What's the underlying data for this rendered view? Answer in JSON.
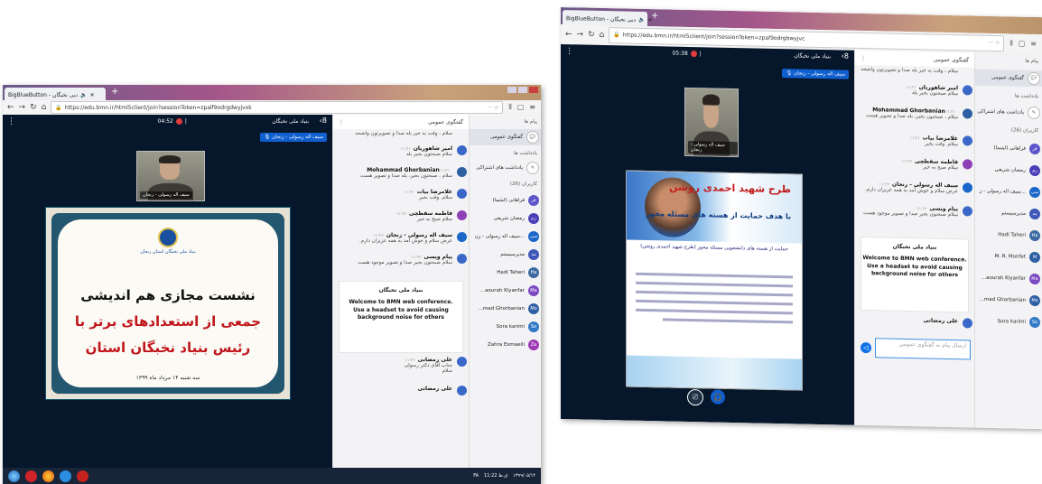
{
  "browser": {
    "tab_title": "BigBlueButton - دبی نخبگان",
    "tab_audio": "🔈",
    "tab_close": "✕",
    "new_tab": "+",
    "url": "https://edu.bmn.ir/html5client/join?sessionToken=zpalf9odrgdwyjvxk",
    "url_right": "https://edu.bmn.ir/html5client/join?sessionToken=zpaf9odrgbwyjvc"
  },
  "left": {
    "meeting_title": "بنیاد ملی نخبگان",
    "timer": "04:52",
    "speaker_badge": "🎙 سیف اله رسولی - زنجان",
    "webcam_caption": "سیف اله رسولی - زنجان",
    "slide": {
      "org": "بنیاد ملی نخبگان استان زنجان",
      "line1": "نشست مجازی هم اندیشی",
      "line2": "جمعی از استعدادهای برتر با",
      "line3": "رئیس بنیاد نخبگان استان",
      "date": "سه شنبه ۱۴ مرداد ماه ۱۳۹۹"
    },
    "chat_header": "گفتگوی عمومی",
    "messages": [
      {
        "name": "",
        "time": "",
        "text": "سلام ، وقت به خیر بله صدا و تصویرتون واضحه"
      },
      {
        "name": "امیر شاهوریان",
        "time": "۱۱:۲۱",
        "text": "سلام صبحتون بخیر بله"
      },
      {
        "name": "Mohammad Ghorbanian",
        "time": "۱۱:۲۱",
        "text": "سلام ، صبحتون بخیر، بله صدا و تصویر هست"
      },
      {
        "name": "غلامرضا بیات",
        "time": "۱۱:۲۱",
        "text": "سلام. وقت بخیر"
      },
      {
        "name": "فاطمه سقطچی",
        "time": "۱۱:۲۲",
        "text": "سلام صبح به خیر"
      },
      {
        "name": "سیف اله رسولی - زنجان",
        "time": "۱۱:۲۲",
        "text": "عرض سلام و خوش آمد به همه عزیزان دارم."
      },
      {
        "name": "پیام ویسی",
        "time": "۱۱:۲۲",
        "text": "سلام صبحتون بخیر صدا و تصویر موجود هست"
      }
    ],
    "welcome": {
      "title": "بنیاد ملی نخبگان",
      "line1": "Welcome to BMN web conference.",
      "line2": "Use a headset to avoid causing",
      "line3": "background noise for others"
    },
    "msg_after": [
      {
        "name": "علی رمضانی",
        "time": "۱۱:۲۲",
        "text": "جناب آقای دکتر رسولی"
      },
      {
        "name": "",
        "time": "",
        "text": "سلام"
      },
      {
        "name": "علی رمضانی",
        "time": "",
        "text": ""
      }
    ],
    "side": {
      "messages_header": "پیام ها",
      "chat_item": "گفتگوی عمومی",
      "notes_header": "یادداشت ها",
      "notes_item": "یادداشت های اشتراکی",
      "users_header": "کاربران (26)",
      "users": [
        {
          "name": "فراهانی (لشما)",
          "initial": "فر",
          "color": "#5b55c9"
        },
        {
          "name": "رمضان شریفی",
          "initial": "رم",
          "color": "#4a3fb8"
        },
        {
          "name": "سیف اله رسولی - زن...",
          "initial": "سی",
          "color": "#1a66c9"
        },
        {
          "name": "مدیرسیستم",
          "initial": "مد",
          "color": "#3f57b8"
        },
        {
          "name": "Hadi Taheri",
          "initial": "Ha",
          "color": "#3d6ba1"
        },
        {
          "name": "...aourah Kiyanfar",
          "initial": "Ma",
          "color": "#7b48c2"
        },
        {
          "name": "...mad Ghorbanian",
          "initial": "Mo",
          "color": "#2d5fa3"
        },
        {
          "name": "Sora karimi",
          "initial": "So",
          "color": "#327ac7"
        },
        {
          "name": "Zahra Esmaeili",
          "initial": "Za",
          "color": "#9e3ab4"
        }
      ]
    },
    "taskbar": {
      "tray_lang": "FA",
      "tray_time": "11:22 ق.ظ",
      "tray_date": "۱۳۹۹/۰۵/۱۴"
    }
  },
  "right": {
    "meeting_title": "بنیاد ملی نخبگان",
    "timer": "05:38",
    "speaker_badge": "🎙 سیف اله رسولی - زنجان",
    "webcam_caption": "سیف اله رسولی - زنجان",
    "slide": {
      "banner_title": "طرح شهید احمدی روشن",
      "banner_sub": "با هدف حمایت از هسته های مسئله محور",
      "body_title": "حمایت از هسته های دانشجویی مسئله محور (طرح شهید احمدی روشن)"
    },
    "chat_header": "گفتگوی عمومی",
    "messages": [
      {
        "name": "",
        "time": "",
        "text": "سلام ، وقت به خیر بله صدا و تصویرتون واضحه"
      },
      {
        "name": "امیر شاهوریان",
        "time": "۱۱:۲۱",
        "text": "سلام صبحتون بخیر بله"
      },
      {
        "name": "Mohammad Ghorbanian",
        "time": "۱۱:۲۱",
        "text": "سلام ، صبحتون بخیر، بله صدا و تصویر هست"
      },
      {
        "name": "غلامرضا بیات",
        "time": "۱۱:۲۱",
        "text": "سلام. وقت بخیر"
      },
      {
        "name": "فاطمه سقطچی",
        "time": "۱۱:۲۲",
        "text": "سلام صبح به خیر"
      },
      {
        "name": "سیف اله رسولی - زنجان",
        "time": "۱۱:۲۲",
        "text": "عرض سلام و خوش آمد به همه عزیزان دارم."
      },
      {
        "name": "پیام ویسی",
        "time": "۱۱:۲۲",
        "text": "سلام صبحتون بخیر صدا و تصویر موجود هست"
      }
    ],
    "welcome": {
      "title": "بنیاد ملی نخبگان",
      "line1": "Welcome to BMN web conference.",
      "line2": "Use a headset to avoid causing",
      "line3": "background noise for others"
    },
    "msg_after_name": "علی رمضانی",
    "input_placeholder": "ارسال پیام به گفتگوی عمومی",
    "side": {
      "messages_header": "پیام ها",
      "chat_item": "گفتگوی عمومی",
      "notes_header": "یادداشت ها",
      "notes_item": "یادداشت های اشتراکی",
      "users_header": "کاربران (26)",
      "users": [
        {
          "name": "فراهانی (لشما)",
          "initial": "فر",
          "color": "#5b55c9"
        },
        {
          "name": "رمضان شریفی",
          "initial": "رم",
          "color": "#4a3fb8"
        },
        {
          "name": "سیف اله رسولی - ز...",
          "initial": "سی",
          "color": "#1a66c9"
        },
        {
          "name": "مدیرسیستم",
          "initial": "مد",
          "color": "#3f57b8"
        },
        {
          "name": "Hadi Taheri",
          "initial": "Ha",
          "color": "#3d6ba1"
        },
        {
          "name": "M. R. Monfet",
          "initial": "M",
          "color": "#2d5fa3"
        },
        {
          "name": "...aourah Kiyanfar",
          "initial": "Ma",
          "color": "#7b48c2"
        },
        {
          "name": "...mad Ghorbanian",
          "initial": "Mo",
          "color": "#2d5fa3"
        },
        {
          "name": "Sora karimi",
          "initial": "So",
          "color": "#327ac7"
        }
      ]
    }
  },
  "colors": {
    "video_bg": "#06172b",
    "accent": "#0f5fcf",
    "record": "#e03b3b"
  }
}
